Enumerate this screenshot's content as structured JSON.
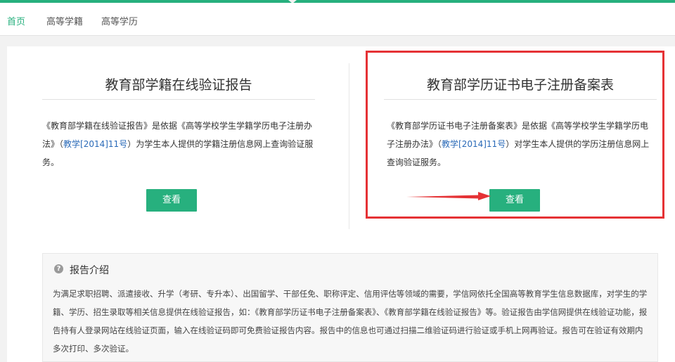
{
  "nav": {
    "items": [
      {
        "label": "首页"
      },
      {
        "label": "高等学籍"
      },
      {
        "label": "高等学历"
      }
    ]
  },
  "cards": [
    {
      "title": "教育部学籍在线验证报告",
      "desc_pre": "《教育部学籍在线验证报告》是依据《高等学校学生学籍学历电子注册办法》（",
      "desc_link": "教学[2014]11号",
      "desc_post": "）为学生本人提供的学籍注册信息网上查询验证服务。",
      "button": "查看"
    },
    {
      "title": "教育部学历证书电子注册备案表",
      "desc_pre": "《教育部学历证书电子注册备案表》是依据《高等学校学生学籍学历电子注册办法》（",
      "desc_link": "教学[2014]11号",
      "desc_post": "）对学生本人提供的学历注册信息网上查询验证服务。",
      "button": "查看"
    }
  ],
  "intro": {
    "icon": "question-circle-icon",
    "title": "报告介绍",
    "text": "为满足求职招聘、派遣接收、升学（考研、专升本）、出国留学、干部任免、职称评定、信用评估等领域的需要，学信网依托全国高等教育学生信息数据库，对学生的学籍、学历、招生录取等相关信息提供在线验证报告，如：《教育部学历证书电子注册备案表》、《教育部学籍在线验证报告》等。验证报告由学信网提供在线验证功能，报告持有人登录网站在线验证页面，输入在线验证码即可免费验证报告内容。报告中的信息也可通过扫描二维验证码进行验证或手机上网再验证。报告可在验证有效期内多次打印、多次验证。"
  },
  "colors": {
    "accent": "#27b07e",
    "link": "#2a6ab8",
    "highlight": "#e53235"
  }
}
